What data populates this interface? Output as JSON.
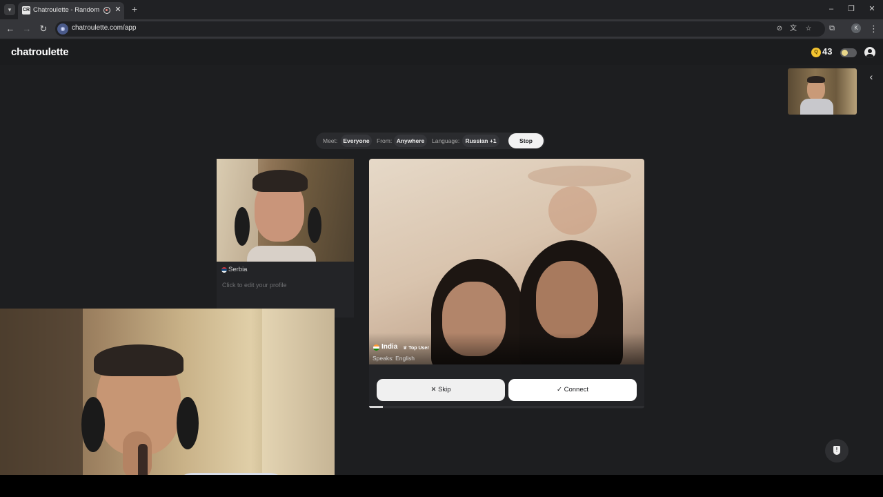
{
  "browser": {
    "tab_title": "Chatroulette - Random video chat",
    "url": "chatroulette.com/app",
    "profile_initial": "K",
    "new_tab_glyph": "+",
    "icons": [
      "tab-list-icon",
      "favicon-icon",
      "recording-icon",
      "close-icon",
      "back-icon",
      "forward-icon",
      "reload-icon",
      "camera-off-icon",
      "translate-icon",
      "star-icon",
      "extensions-icon",
      "menu-icon",
      "minimize-icon",
      "maximize-icon",
      "close-window-icon"
    ]
  },
  "header": {
    "logo": "chatroulette",
    "coins": "43",
    "coin_symbol": "Q"
  },
  "filters": {
    "meet_label": "Meet:",
    "meet_value": "Everyone",
    "from_label": "From:",
    "from_value": "Anywhere",
    "language_label": "Language:",
    "language_value": "Russian +1",
    "stop_label": "Stop"
  },
  "self": {
    "location": "Serbia",
    "edit_profile": "Click to edit your profile"
  },
  "partner": {
    "country": "India",
    "badge": "♛ Top User",
    "speaks": "Speaks: English",
    "progress": 0.05
  },
  "actions": {
    "skip_label": "Skip",
    "connect_label": "Connect",
    "skip_glyph": "✕",
    "connect_glyph": "✓"
  },
  "colors": {
    "background": "#1d1e20",
    "coin": "#f4c430",
    "button_light": "#f0f0f0"
  }
}
